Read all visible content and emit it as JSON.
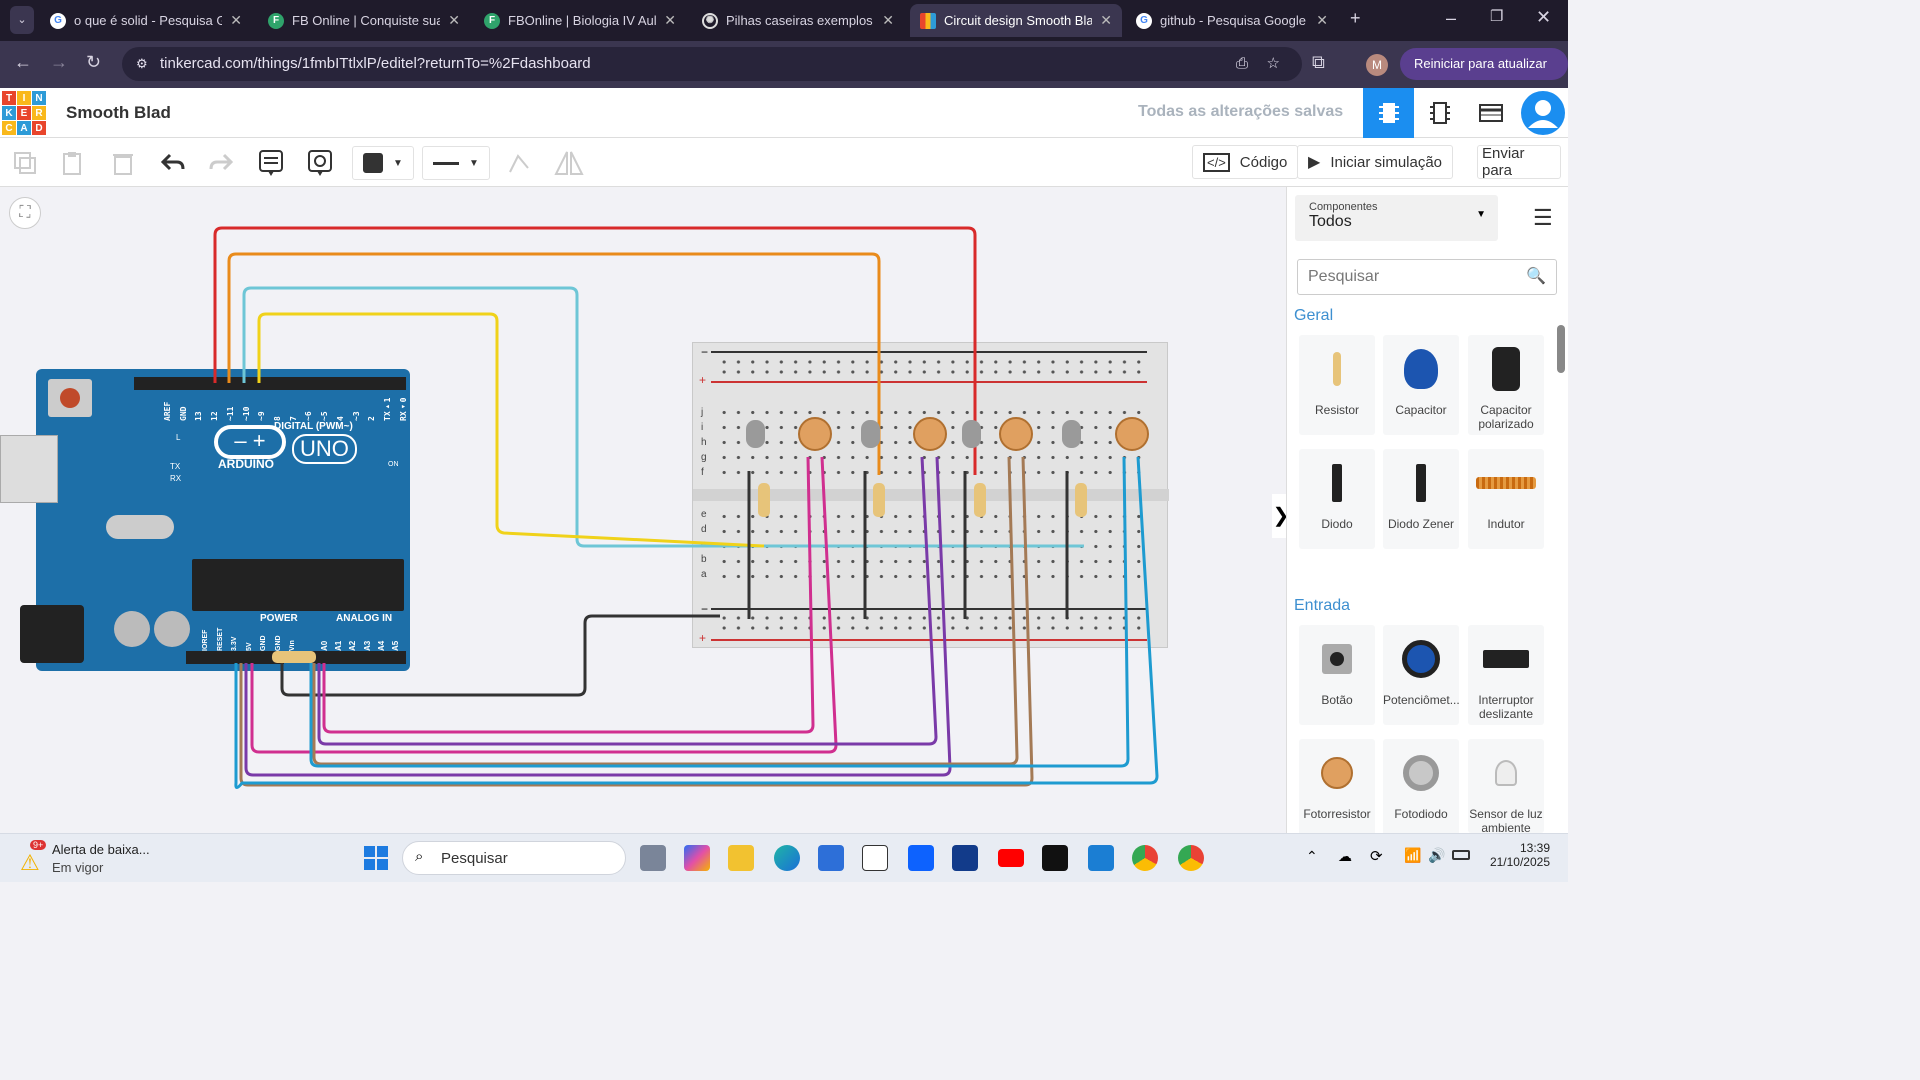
{
  "browser": {
    "tabs": [
      {
        "title": "o que é solid - Pesquisa Go",
        "icon": "google-icon"
      },
      {
        "title": "FB Online | Conquiste sua a",
        "icon": "fb-online-icon"
      },
      {
        "title": "FBOnline | Biologia IV Aula",
        "icon": "fb-online-icon"
      },
      {
        "title": "Pilhas caseiras exemplos",
        "icon": "chatgpt-icon"
      },
      {
        "title": "Circuit design Smooth Blad",
        "icon": "tinkercad-icon"
      },
      {
        "title": "github - Pesquisa Google",
        "icon": "google-icon"
      }
    ],
    "url": "tinkercad.com/things/1fmbITtlxlP/editel?returnTo=%2Fdashboard",
    "update_label": "Reiniciar para atualizar",
    "profile_initial": "M"
  },
  "header": {
    "title": "Smooth Blad",
    "saved": "Todas as alterações salvas",
    "logo": [
      "T",
      "I",
      "N",
      "K",
      "E",
      "R",
      "C",
      "A",
      "D"
    ]
  },
  "toolbar": {
    "code_label": "Código",
    "sim_label": "Iniciar simulação",
    "send_label": "Enviar para"
  },
  "board": {
    "brand": "ARDUINO",
    "model": "UNO",
    "digital_label": "DIGITAL (PWM~)",
    "power_label": "POWER",
    "analog_label": "ANALOG IN",
    "digital_pins": [
      "AREF",
      "GND",
      "13",
      "12",
      "~11",
      "~10",
      "~9",
      "8",
      "7",
      "~6",
      "~5",
      "4",
      "~3",
      "2",
      "TX▸1",
      "RX◂0"
    ],
    "power_pins": [
      "IOREF",
      "RESET",
      "3.3V",
      "5V",
      "GND",
      "GND",
      "Vin"
    ],
    "analog_pins": [
      "A0",
      "A1",
      "A2",
      "A3",
      "A4",
      "A5"
    ],
    "l_label": "L",
    "tx_label": "TX",
    "rx_label": "RX",
    "on_label": "ON"
  },
  "breadboard": {
    "rows": [
      "a",
      "b",
      "c",
      "d",
      "e",
      "f",
      "g",
      "h",
      "i",
      "j"
    ],
    "minus": "−",
    "plus": "+"
  },
  "panel": {
    "components_label": "Componentes",
    "components_value": "Todos",
    "search_placeholder": "Pesquisar",
    "section_general": "Geral",
    "section_input": "Entrada",
    "general": [
      "Resistor",
      "Capacitor",
      "Capacitor polarizado",
      "Diodo",
      "Diodo Zener",
      "Indutor"
    ],
    "input": [
      "Botão",
      "Potenciômet...",
      "Interruptor deslizante",
      "Fotorresistor",
      "Fotodiodo",
      "Sensor de luz ambiente"
    ]
  },
  "taskbar": {
    "alert_title": "Alerta de baixa...",
    "alert_sub": "Em vigor",
    "alert_badge": "9+",
    "search_label": "Pesquisar",
    "time": "13:39",
    "date": "21/10/2025"
  }
}
